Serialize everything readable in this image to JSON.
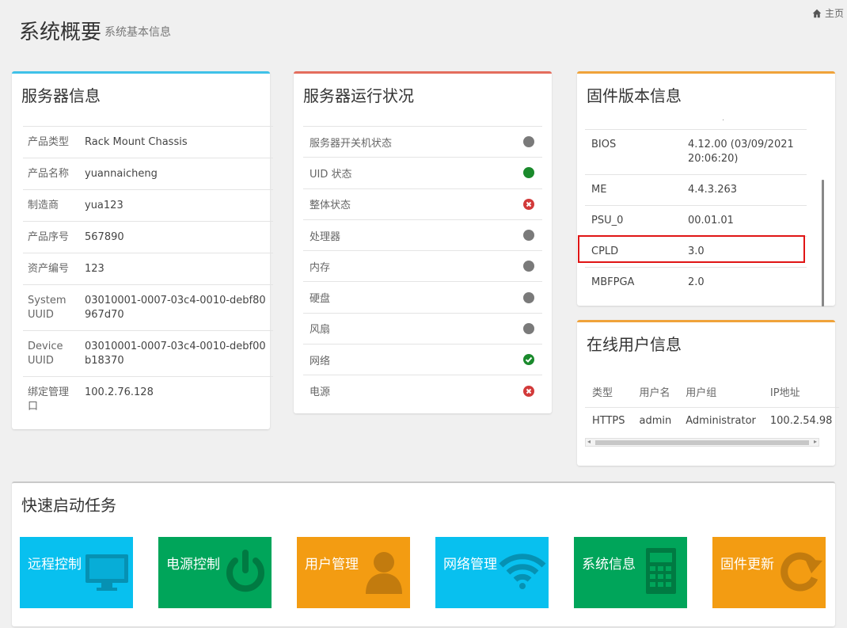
{
  "header": {
    "title": "系统概要",
    "subtitle": "系统基本信息",
    "home_label": "主页"
  },
  "server_info": {
    "title": "服务器信息",
    "rows": [
      {
        "key": "产品类型",
        "value": "Rack Mount Chassis"
      },
      {
        "key": "产品名称",
        "value": "yuannaicheng"
      },
      {
        "key": "制造商",
        "value": "yua123"
      },
      {
        "key": "产品序号",
        "value": "567890"
      },
      {
        "key": "资产编号",
        "value": "123"
      },
      {
        "key": "System UUID",
        "value": "03010001-0007-03c4-0010-debf80967d70"
      },
      {
        "key": "Device UUID",
        "value": "03010001-0007-03c4-0010-debf00b18370"
      },
      {
        "key": "绑定管理口",
        "value": "100.2.76.128"
      }
    ]
  },
  "status": {
    "title": "服务器运行状况",
    "rows": [
      {
        "label": "服务器开关机状态",
        "state": "gray"
      },
      {
        "label": "UID 状态",
        "state": "green"
      },
      {
        "label": "整体状态",
        "state": "error"
      },
      {
        "label": "处理器",
        "state": "gray"
      },
      {
        "label": "内存",
        "state": "gray"
      },
      {
        "label": "硬盘",
        "state": "gray"
      },
      {
        "label": "风扇",
        "state": "gray"
      },
      {
        "label": "网络",
        "state": "ok"
      },
      {
        "label": "电源",
        "state": "error"
      }
    ]
  },
  "firmware": {
    "title": "固件版本信息",
    "rows": [
      {
        "key": "BIOS",
        "value": "4.12.00 (03/09/2021 20:06:20)"
      },
      {
        "key": "ME",
        "value": "4.4.3.263"
      },
      {
        "key": "PSU_0",
        "value": "00.01.01"
      },
      {
        "key": "CPLD",
        "value": "3.0"
      },
      {
        "key": "MBFPGA",
        "value": "2.0"
      }
    ]
  },
  "online_users": {
    "title": "在线用户信息",
    "columns": [
      "类型",
      "用户名",
      "用户组",
      "IP地址"
    ],
    "rows": [
      [
        "HTTPS",
        "admin",
        "Administrator",
        "100.2.54.98"
      ]
    ]
  },
  "quick_tasks": {
    "title": "快速启动任务",
    "tiles": [
      {
        "label": "远程控制",
        "icon": "monitor-icon",
        "color": "#08c0ef"
      },
      {
        "label": "电源控制",
        "icon": "power-icon",
        "color": "#00a55a"
      },
      {
        "label": "用户管理",
        "icon": "user-icon",
        "color": "#f39c12"
      },
      {
        "label": "网络管理",
        "icon": "wifi-icon",
        "color": "#08c0ef"
      },
      {
        "label": "系统信息",
        "icon": "calculator-icon",
        "color": "#00a55a"
      },
      {
        "label": "固件更新",
        "icon": "refresh-icon",
        "color": "#f39c12"
      }
    ]
  }
}
